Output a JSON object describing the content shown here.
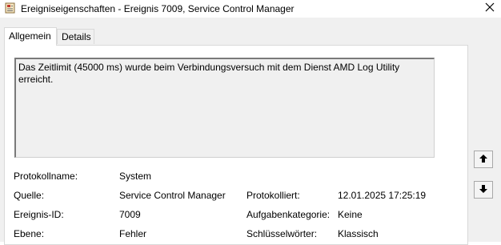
{
  "window": {
    "title": "Ereigniseigenschaften - Ereignis 7009, Service Control Manager"
  },
  "tabs": [
    {
      "label": "Allgemein",
      "active": true
    },
    {
      "label": "Details",
      "active": false
    }
  ],
  "description": "Das Zeitlimit (45000 ms) wurde beim Verbindungsversuch mit dem Dienst AMD Log Utility erreicht.",
  "fields": {
    "protokollname": {
      "label": "Protokollname:",
      "value": "System"
    },
    "quelle": {
      "label": "Quelle:",
      "value": "Service Control Manager"
    },
    "protokolliert": {
      "label": "Protokolliert:",
      "value": "12.01.2025 17:25:19"
    },
    "ereignis_id": {
      "label": "Ereignis-ID:",
      "value": "7009"
    },
    "aufgabenkategorie": {
      "label": "Aufgabenkategorie:",
      "value": "Keine"
    },
    "ebene": {
      "label": "Ebene:",
      "value": "Fehler"
    },
    "schluesselwoerter": {
      "label": "Schlüsselwörter:",
      "value": "Klassisch"
    }
  },
  "icons": {
    "app": "event-properties-icon",
    "close": "close-icon",
    "up": "arrow-up-icon",
    "down": "arrow-down-icon"
  }
}
